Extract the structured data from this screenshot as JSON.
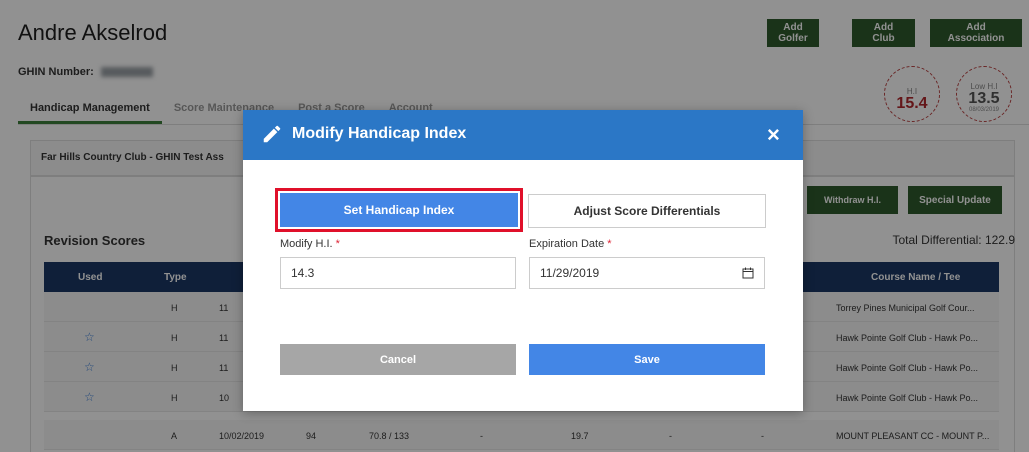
{
  "header": {
    "golfer_name": "Andre Akselrod",
    "ghin_label": "GHIN Number:",
    "add_golfer": "Add Golfer",
    "add_club": "Add Club",
    "add_association": "Add Association"
  },
  "handicap_badges": {
    "hi_label": "H.I",
    "hi_value": "15.4",
    "low_hi_label": "Low H.I",
    "low_hi_value": "13.5",
    "low_hi_date": "08/03/2019"
  },
  "tabs": [
    {
      "label": "Handicap Management",
      "active": true
    },
    {
      "label": "Score Maintenance"
    },
    {
      "label": "Post a Score"
    },
    {
      "label": "Account"
    }
  ],
  "club_panel": {
    "title": "Far Hills Country Club - GHIN Test Ass"
  },
  "actions": {
    "withdraw": "Withdraw H.I.",
    "special_update": "Special Update"
  },
  "revision": {
    "title": "Revision Scores",
    "total_differential": "Total Differential: 122.9"
  },
  "table": {
    "headers": {
      "used": "Used",
      "type": "Type",
      "course": "Course Name / Tee"
    },
    "rows": [
      {
        "used": "",
        "type": "H",
        "date": "11",
        "course": "Torrey Pines Municipal Golf Cour..."
      },
      {
        "used": "☆",
        "type": "H",
        "date": "11",
        "course": "Hawk Pointe Golf Club - Hawk Po..."
      },
      {
        "used": "☆",
        "type": "H",
        "date": "11",
        "course": "Hawk Pointe Golf Club - Hawk Po..."
      },
      {
        "used": "☆",
        "type": "H",
        "date": "10",
        "course": "Hawk Pointe Golf Club - Hawk Po..."
      },
      {
        "used": "",
        "type": "A",
        "date": "10/02/2019",
        "score": "94",
        "rating": "70.8 / 133",
        "c1": "-",
        "diff": "19.7",
        "c2": "-",
        "c3": "-",
        "course": "MOUNT PLEASANT CC - MOUNT P..."
      }
    ]
  },
  "modal": {
    "title": "Modify Handicap Index",
    "close": "×",
    "tab_set": "Set Handicap Index",
    "tab_adjust": "Adjust Score Differentials",
    "hi_label": "Modify H.I.",
    "hi_value": "14.3",
    "exp_label": "Expiration Date",
    "exp_value": "11/29/2019",
    "required_mark": "*",
    "cancel": "Cancel",
    "save": "Save"
  },
  "colors": {
    "primary_blue": "#4386e6",
    "header_blue": "#2b77c6",
    "dark_green": "#2f5b2d",
    "table_header": "#1c3764",
    "highlight_red": "#e0102a"
  }
}
